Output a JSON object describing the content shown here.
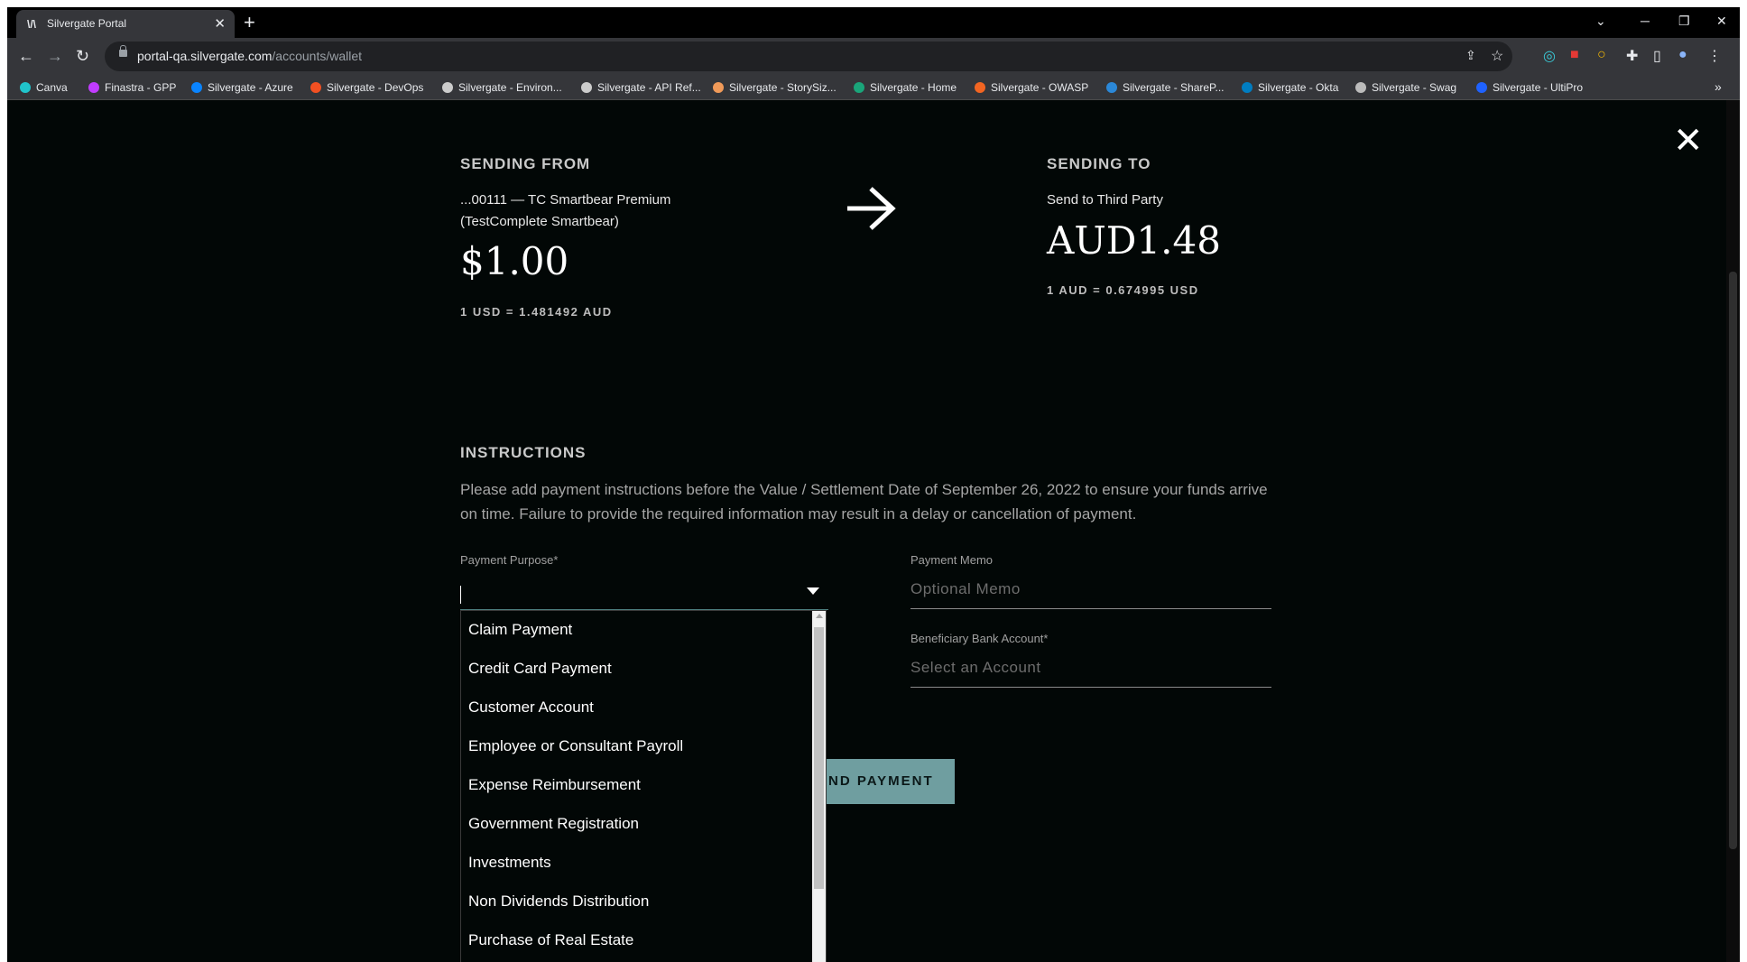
{
  "browser": {
    "tab_title": "Silvergate Portal",
    "tab_favicon": "\\/\\",
    "url_host": "portal-qa.silvergate.com",
    "url_path": "/accounts/wallet",
    "bookmarks": [
      {
        "label": "Canva",
        "color": "#20c4cb"
      },
      {
        "label": "Finastra - GPP",
        "color": "#c13cff"
      },
      {
        "label": "Silvergate - Azure",
        "color": "#0a84ff"
      },
      {
        "label": "Silvergate - DevOps",
        "color": "#f25022"
      },
      {
        "label": "Silvergate - Environ...",
        "color": "#cccccc"
      },
      {
        "label": "Silvergate - API Ref...",
        "color": "#cccccc"
      },
      {
        "label": "Silvergate - StorySiz...",
        "color": "#f09a59"
      },
      {
        "label": "Silvergate - Home",
        "color": "#1aa57a"
      },
      {
        "label": "Silvergate - OWASP",
        "color": "#f26522"
      },
      {
        "label": "Silvergate - ShareP...",
        "color": "#2b88d8"
      },
      {
        "label": "Silvergate - Okta",
        "color": "#007dc1"
      },
      {
        "label": "Silvergate - Swag",
        "color": "#bbbbbb"
      },
      {
        "label": "Silvergate - UltiPro",
        "color": "#1f62ff"
      }
    ],
    "more_bookmarks": "»"
  },
  "transfer": {
    "from": {
      "heading": "SENDING FROM",
      "account_line1": "...00111 — TC Smartbear Premium",
      "account_line2": "(TestComplete Smartbear)",
      "amount": "$1.00",
      "rate": "1 USD = 1.481492 AUD"
    },
    "to": {
      "heading": "SENDING TO",
      "account_line1": "Send to Third Party",
      "amount": "AUD1.48",
      "rate": "1 AUD = 0.674995 USD"
    }
  },
  "instructions": {
    "heading": "INSTRUCTIONS",
    "text": "Please add payment instructions before the Value / Settlement Date of September 26, 2022 to ensure your funds arrive on time. Failure to provide the required information may result in a delay or cancellation of payment."
  },
  "form": {
    "payment_purpose_label": "Payment Purpose*",
    "payment_memo_label": "Payment Memo",
    "payment_memo_placeholder": "Optional Memo",
    "beneficiary_label": "Beneficiary Bank Account*",
    "beneficiary_placeholder": "Select an Account",
    "send_button": "ND PAYMENT",
    "purpose_options": [
      "Claim Payment",
      "Credit Card Payment",
      "Customer Account",
      "Employee or Consultant Payroll",
      "Expense Reimbursement",
      "Government Registration",
      "Investments",
      "Non Dividends Distribution",
      "Purchase of Real Estate"
    ]
  },
  "colors": {
    "page_bg": "#020706",
    "button_bg": "#6f9ea0"
  }
}
